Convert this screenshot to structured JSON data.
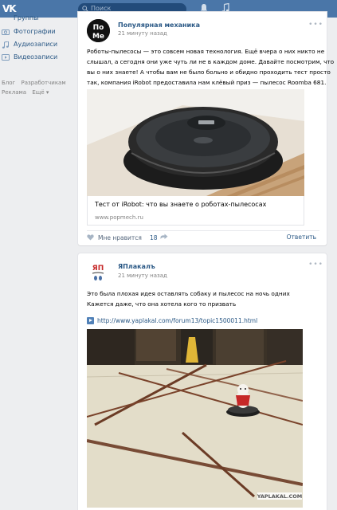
{
  "header": {
    "logo": "VK",
    "search_placeholder": "Поиск"
  },
  "nav": {
    "items": [
      {
        "label": "Группы",
        "icon": "groups-icon"
      },
      {
        "label": "Фотографии",
        "icon": "photos-icon"
      },
      {
        "label": "Аудиозаписи",
        "icon": "music-icon"
      },
      {
        "label": "Видеозаписи",
        "icon": "video-icon"
      }
    ],
    "footer": {
      "blog": "Блог",
      "developers": "Разработчикам",
      "ads": "Реклама",
      "more": "Ещё ▾"
    }
  },
  "posts": [
    {
      "author": "Популярная механика",
      "time": "21 минуту назад",
      "avatar_text": "ПоМе",
      "text": [
        "Роботы-пылесосы — это совсем новая технология. Ещё вчера о них никто не",
        "слышал, а сегодня они уже чуть ли не в каждом доме. Давайте посмотрим, что",
        "вы о них знаете! А чтобы вам не было больно и обидно проходить тест просто",
        "так, компания iRobot предоставила нам клёвый приз — пылесос Roomba 681."
      ],
      "link": {
        "title": "Тест от iRobot: что вы знаете о роботах-пылесосах",
        "url": "www.popmech.ru"
      },
      "likes": {
        "label": "Мне нравится",
        "count": "18"
      },
      "reply": "Ответить"
    },
    {
      "author": "ЯПлакалъ",
      "time": "21 минуту назад",
      "avatar_text": "ЯП",
      "text": [
        "Это была плохая идея оставлять собаку и пылесос на ночь одних",
        "Кажется даже, что она хотела кого то призвать"
      ],
      "link_url": "http://www.yaplakal.com/forum13/topic1500011.html",
      "watermark": "YAPLAKAL.COM"
    }
  ],
  "colors": {
    "header": "#4a76a8",
    "link": "#2a5885",
    "background": "#edeef0"
  }
}
